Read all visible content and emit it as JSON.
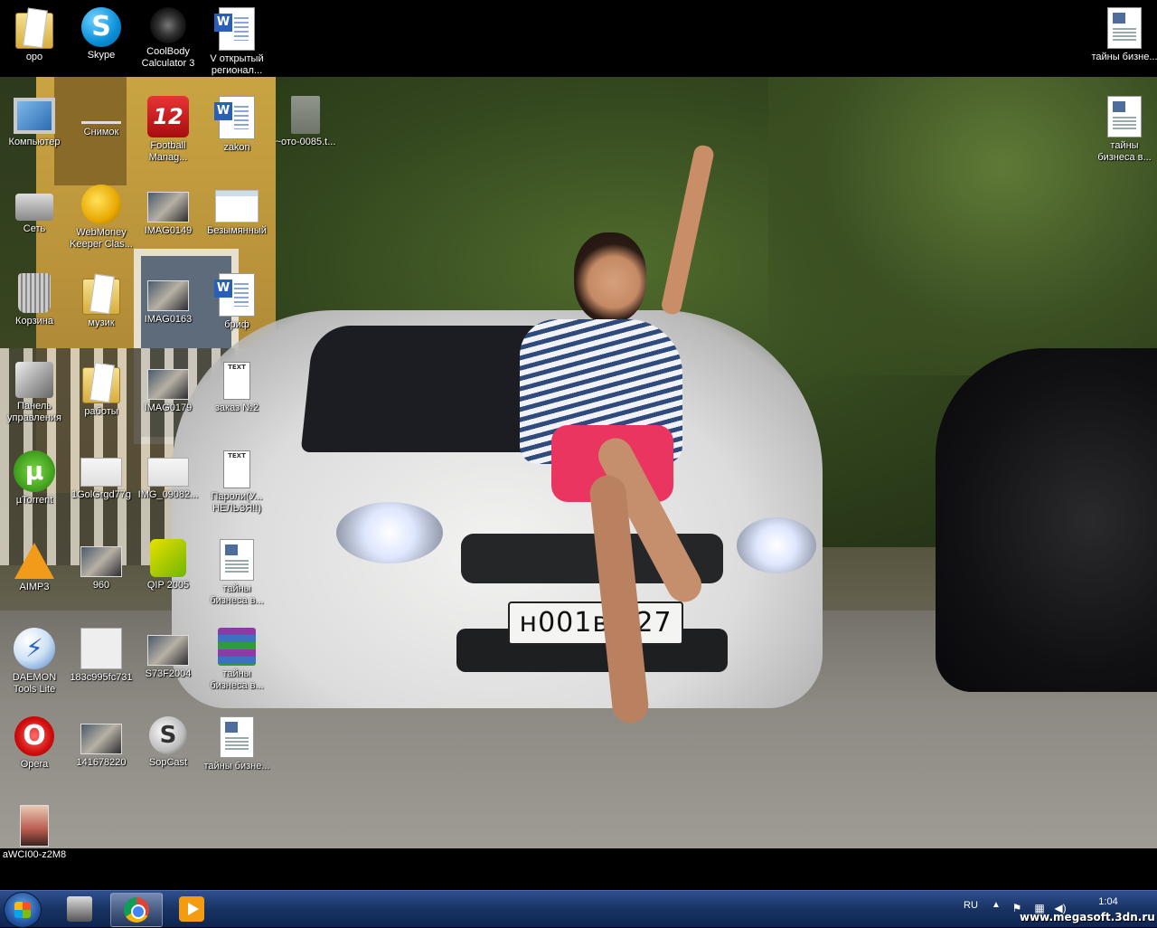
{
  "desktop": {
    "icons": [
      {
        "label": "оро",
        "icon": "folder-icon"
      },
      {
        "label": "Skype",
        "icon": "skype-icon"
      },
      {
        "label": "CoolBody Calculator 3",
        "icon": "dumbbell-icon"
      },
      {
        "label": "V открытый регионал...",
        "icon": "word-document-icon"
      },
      {
        "label": "тайны бизне...",
        "icon": "document-thumbnail-icon"
      },
      {
        "label": "Компьютер",
        "icon": "computer-icon"
      },
      {
        "label": "Снимок",
        "icon": "image-icon"
      },
      {
        "label": "Football Manag...",
        "icon": "football-manager-icon"
      },
      {
        "label": "zakon",
        "icon": "word-document-icon"
      },
      {
        "label": "~ото-0085.t...",
        "icon": "file-icon"
      },
      {
        "label": "тайны бизнеса в...",
        "icon": "document-thumbnail-icon"
      },
      {
        "label": "Сеть",
        "icon": "network-icon"
      },
      {
        "label": "WebMoney Keeper Clas...",
        "icon": "webmoney-icon"
      },
      {
        "label": "IMAG0149",
        "icon": "photo-icon"
      },
      {
        "label": "Безымянный",
        "icon": "paint-image-icon"
      },
      {
        "label": "Корзина",
        "icon": "recycle-bin-icon"
      },
      {
        "label": "музик",
        "icon": "folder-icon"
      },
      {
        "label": "IMAG0163",
        "icon": "photo-icon"
      },
      {
        "label": "бриф",
        "icon": "word-document-icon"
      },
      {
        "label": "Панель управления",
        "icon": "control-panel-icon"
      },
      {
        "label": "работы",
        "icon": "folder-icon"
      },
      {
        "label": "IMAG0179",
        "icon": "photo-icon"
      },
      {
        "label": "заказ №2",
        "icon": "text-file-icon"
      },
      {
        "label": "µTorrent",
        "icon": "utorrent-icon"
      },
      {
        "label": "1GolGrgd77g",
        "icon": "photo-icon"
      },
      {
        "label": "IMG_09082...",
        "icon": "photo-icon"
      },
      {
        "label": "Пароли(У... НЕЛЬЗЯ!!)",
        "icon": "text-file-icon"
      },
      {
        "label": "AIMP3",
        "icon": "aimp-icon"
      },
      {
        "label": "960",
        "icon": "photo-icon"
      },
      {
        "label": "QIP 2005",
        "icon": "qip-icon"
      },
      {
        "label": "тайны бизнеса в...",
        "icon": "document-thumbnail-icon"
      },
      {
        "label": "DAEMON Tools Lite",
        "icon": "daemon-tools-icon"
      },
      {
        "label": "183c995fc731",
        "icon": "image-icon"
      },
      {
        "label": "S73F2004",
        "icon": "photo-icon"
      },
      {
        "label": "тайны бизнеса в...",
        "icon": "winrar-archive-icon"
      },
      {
        "label": "Opera",
        "icon": "opera-icon"
      },
      {
        "label": "141678220",
        "icon": "photo-icon"
      },
      {
        "label": "SopCast",
        "icon": "sopcast-icon"
      },
      {
        "label": "тайны бизне...",
        "icon": "document-thumbnail-icon"
      },
      {
        "label": "aWCI00-z2M8",
        "icon": "photo-icon"
      }
    ],
    "wallpaper_plate": "н001в□27"
  },
  "taskbar": {
    "start_icon": "windows-logo-icon",
    "items": [
      {
        "icon": "file-manager-icon",
        "active": false
      },
      {
        "icon": "chrome-icon",
        "active": true
      },
      {
        "icon": "media-player-icon",
        "active": false
      }
    ],
    "tray": {
      "language": "RU",
      "expand_arrow": "▲",
      "icons": [
        "flag-icon",
        "network-tray-icon",
        "volume-icon"
      ],
      "time": "1:04"
    }
  },
  "watermark": "www.megasoft.3dn.ru"
}
